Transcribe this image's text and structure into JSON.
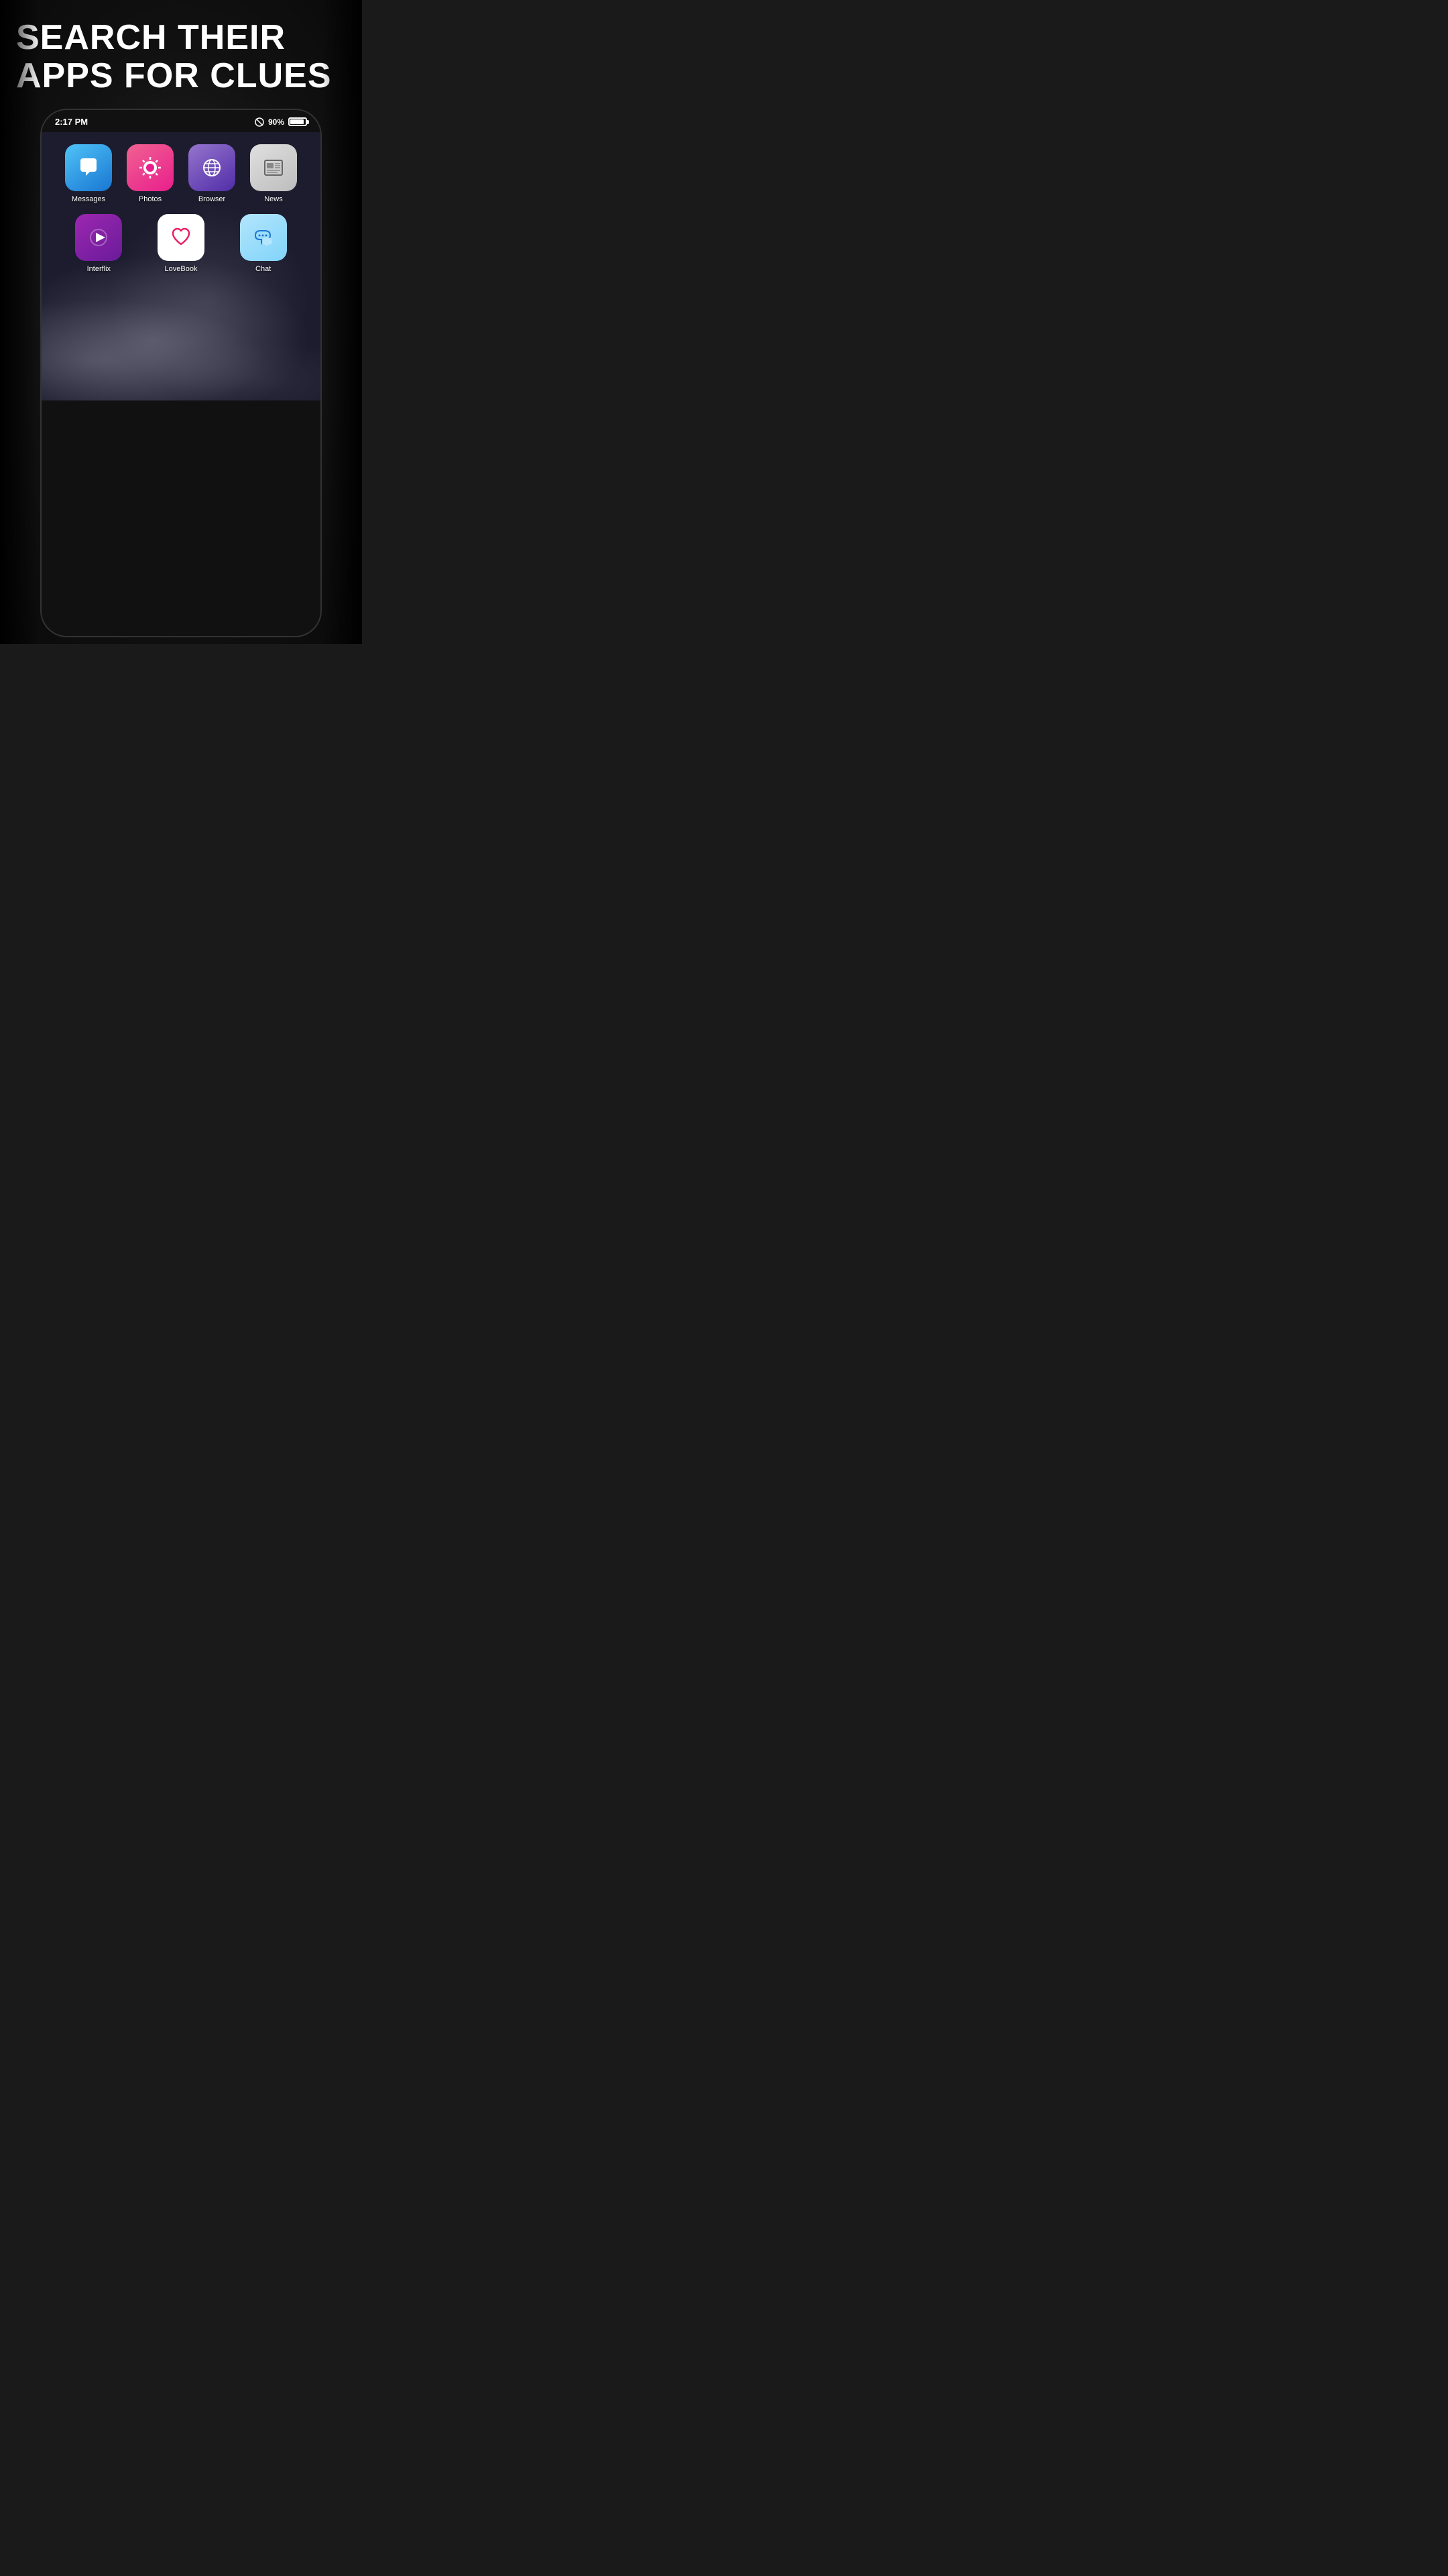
{
  "header": {
    "line1": "SEARCH THEIR",
    "line2": "APPS FOR CLUES"
  },
  "status_bar": {
    "time": "2:17 PM",
    "battery_percent": "90%"
  },
  "apps_row1": [
    {
      "id": "messages",
      "label": "Messages",
      "icon_type": "messages"
    },
    {
      "id": "photos",
      "label": "Photos",
      "icon_type": "photos"
    },
    {
      "id": "browser",
      "label": "Browser",
      "icon_type": "browser"
    },
    {
      "id": "news",
      "label": "News",
      "icon_type": "news"
    }
  ],
  "apps_row2": [
    {
      "id": "interflix",
      "label": "Interflix",
      "icon_type": "interflix"
    },
    {
      "id": "lovebook",
      "label": "LoveBook",
      "icon_type": "lovebook"
    },
    {
      "id": "chat",
      "label": "Chat",
      "icon_type": "chat"
    }
  ]
}
